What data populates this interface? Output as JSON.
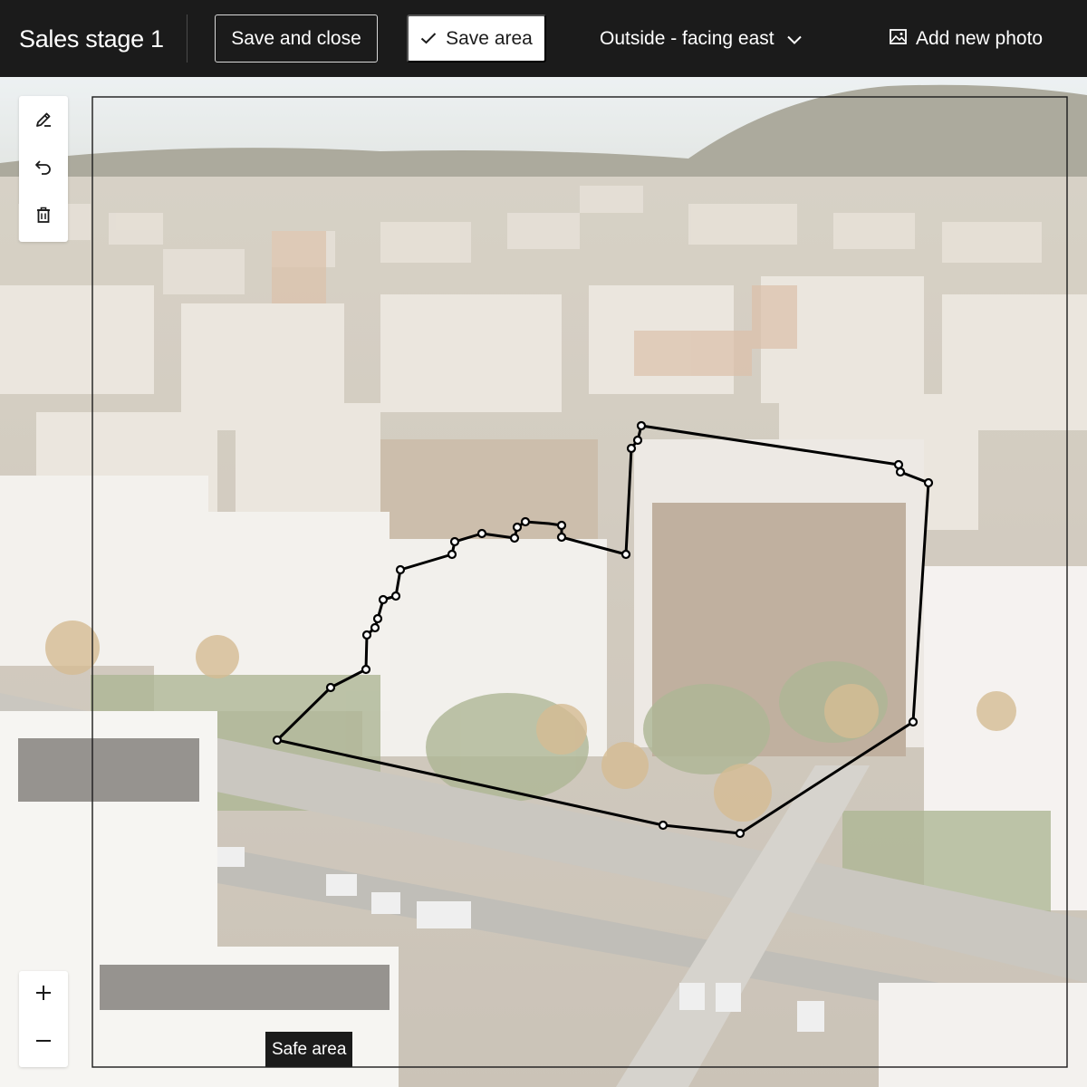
{
  "header": {
    "title": "Sales stage 1",
    "save_close_label": "Save and close",
    "save_area_label": "Save area",
    "view_select": "Outside - facing east",
    "add_photo_label": "Add new photo"
  },
  "tools": {
    "icons": [
      "pencil-icon",
      "undo-icon",
      "trash-icon"
    ]
  },
  "zoom": {
    "in_icon": "plus-icon",
    "out_icon": "minus-icon"
  },
  "canvas": {
    "safe_area_label": "Safe area"
  },
  "colors": {
    "topbar": "#1b1b1b",
    "outline": "#000000",
    "handle_fill": "#ffffff"
  }
}
